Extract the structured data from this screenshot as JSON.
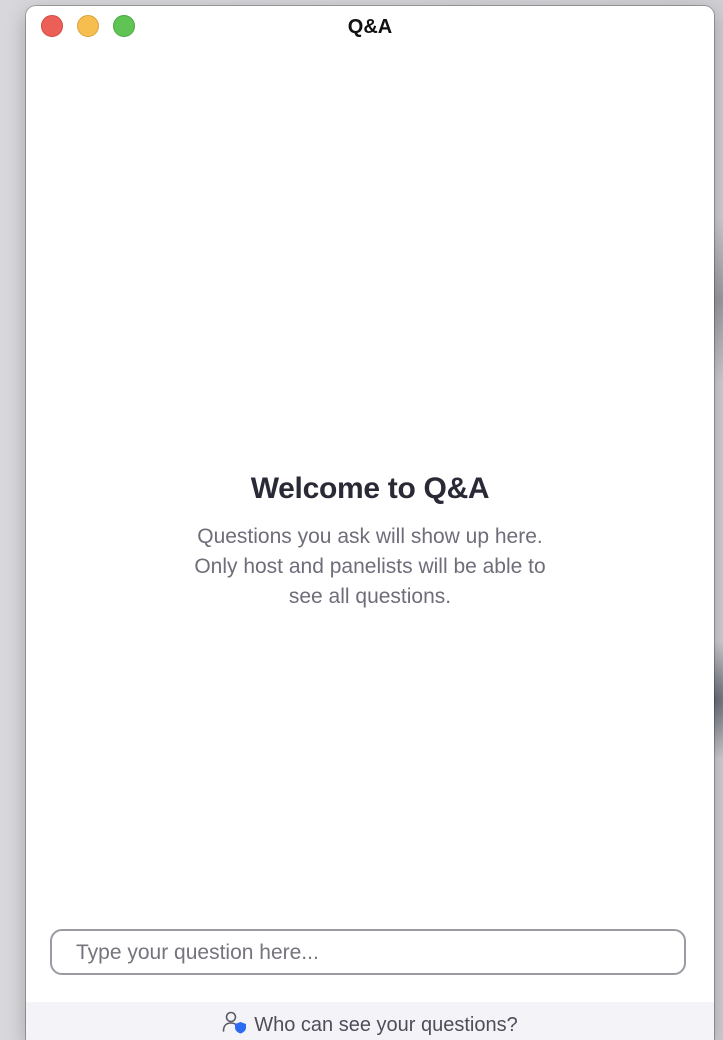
{
  "window": {
    "title": "Q&A"
  },
  "welcome": {
    "title": "Welcome to Q&A",
    "description": "Questions you ask will show up here. Only host and panelists will be able to see all questions."
  },
  "question_input": {
    "placeholder": "Type your question here...",
    "value": ""
  },
  "footer": {
    "who_can_see_label": "Who can see your questions?",
    "icon": "user-shield-icon"
  },
  "colors": {
    "close": "#ec5f57",
    "minimize": "#f5be4f",
    "zoom": "#5fc454",
    "shield": "#2d6cf0"
  }
}
